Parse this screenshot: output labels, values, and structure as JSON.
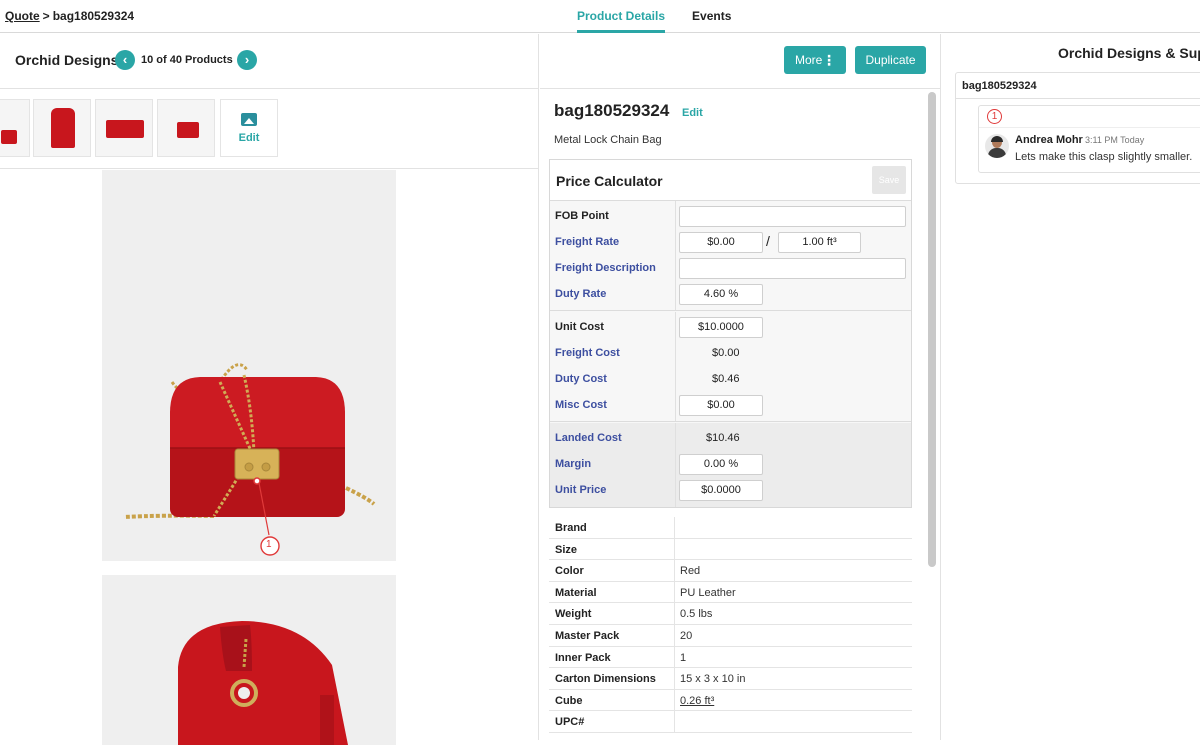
{
  "breadcrumb": {
    "root": "Quote",
    "separator": ">",
    "current": "bag180529324"
  },
  "tabs": [
    {
      "label": "Product Details",
      "active": true
    },
    {
      "label": "Events",
      "active": false
    }
  ],
  "left": {
    "supplier": "Orchid Designs",
    "product_count": "10 of 40 Products",
    "thumb_edit_label": "Edit",
    "photo_marker": "1"
  },
  "toolbar": {
    "more_label": "More",
    "more_icon": "⋮",
    "duplicate_label": "Duplicate"
  },
  "product": {
    "sku": "bag180529324",
    "edit_label": "Edit",
    "description": "Metal Lock Chain Bag"
  },
  "price_calculator": {
    "title": "Price Calculator",
    "save_label": "Save",
    "fob_point": {
      "label": "FOB Point",
      "value": ""
    },
    "freight_rate": {
      "label": "Freight Rate",
      "value": "$0.00",
      "per": "1.00 ft³",
      "separator": "/"
    },
    "freight_description": {
      "label": "Freight Description",
      "value": ""
    },
    "duty_rate": {
      "label": "Duty Rate",
      "value": "4.60 %"
    },
    "unit_cost": {
      "label": "Unit Cost",
      "value": "$10.0000"
    },
    "freight_cost": {
      "label": "Freight Cost",
      "value": "$0.00"
    },
    "duty_cost": {
      "label": "Duty Cost",
      "value": "$0.46"
    },
    "misc_cost": {
      "label": "Misc Cost",
      "value": "$0.00"
    },
    "landed_cost": {
      "label": "Landed Cost",
      "value": "$10.46"
    },
    "margin": {
      "label": "Margin",
      "value": "0.00 %"
    },
    "unit_price": {
      "label": "Unit Price",
      "value": "$0.0000"
    }
  },
  "attributes": [
    {
      "label": "Brand",
      "value": ""
    },
    {
      "label": "Size",
      "value": ""
    },
    {
      "label": "Color",
      "value": "Red"
    },
    {
      "label": "Material",
      "value": "PU Leather"
    },
    {
      "label": "Weight",
      "value": "0.5 lbs"
    },
    {
      "label": "Master Pack",
      "value": "20"
    },
    {
      "label": "Inner Pack",
      "value": "1"
    },
    {
      "label": "Carton Dimensions",
      "value": "15 x 3 x 10 in"
    },
    {
      "label": "Cube",
      "value": "0.26 ft³"
    },
    {
      "label": "UPC#",
      "value": ""
    }
  ],
  "comments": {
    "panel_title": "Orchid Designs & Suppl",
    "thread_id": "bag180529324",
    "items": [
      {
        "marker": "1",
        "author": "Andrea Mohr",
        "time": "3:11 PM Today",
        "text": "Lets make this clasp slightly smaller."
      }
    ]
  },
  "colors": {
    "accent": "#2aa6a6",
    "label_blue": "#3d4fa0",
    "product_red": "#c8161d",
    "marker_red": "#e03a3a"
  }
}
